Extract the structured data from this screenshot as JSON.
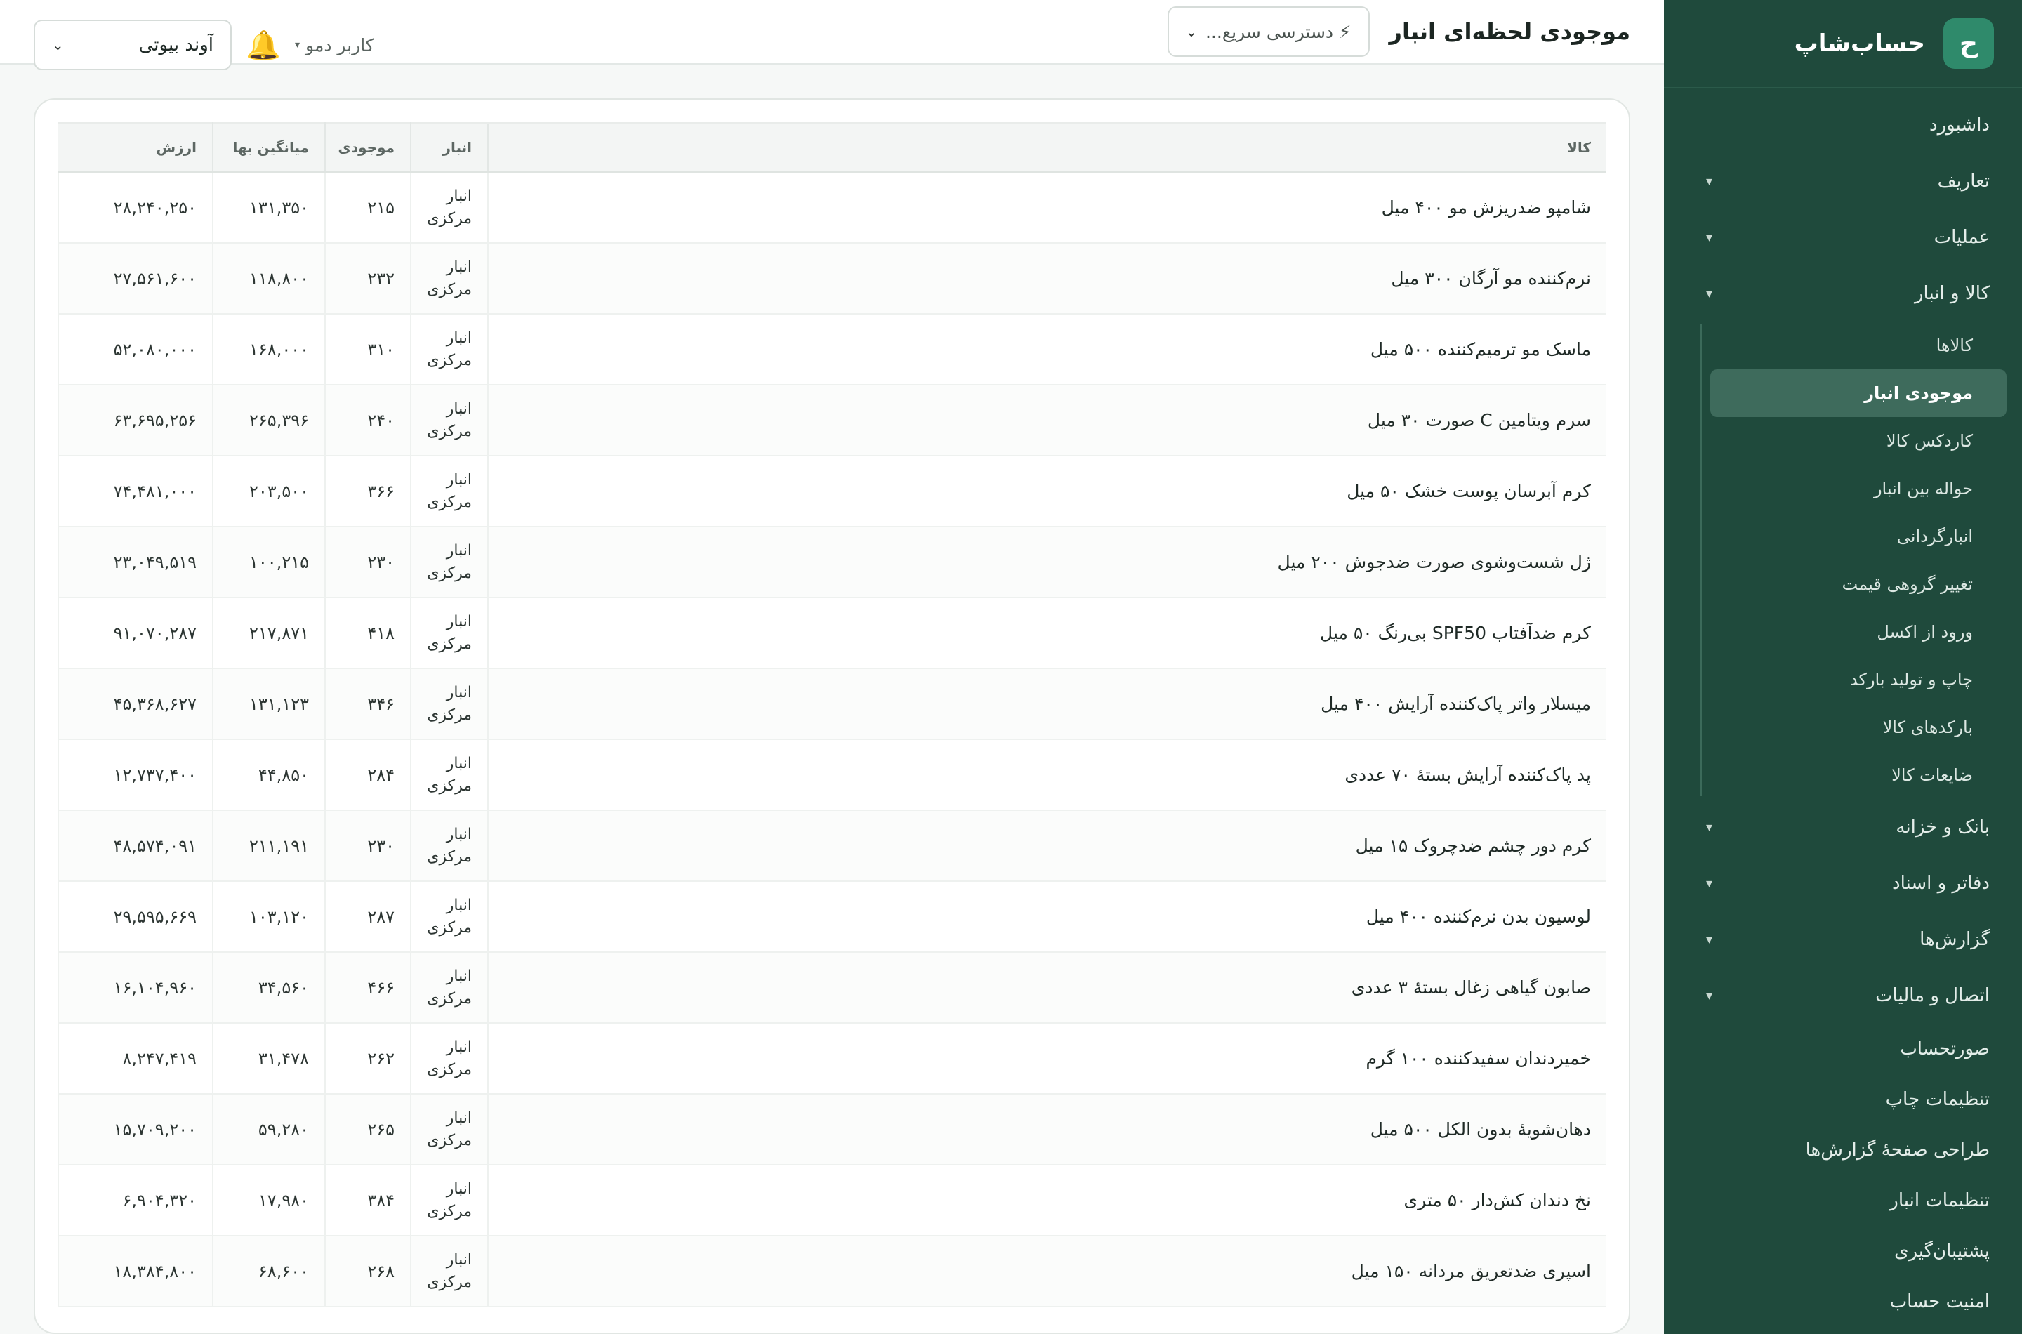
{
  "brand": {
    "logo_letter": "ح",
    "name": "حساب‌شاپ"
  },
  "sidebar": {
    "items": [
      {
        "label": "داشبورد"
      },
      {
        "label": "تعاریف",
        "caret": "▾"
      },
      {
        "label": "عملیات",
        "caret": "▾"
      },
      {
        "label": "کالا و انبار",
        "caret": "▾"
      }
    ],
    "sub_items": [
      {
        "label": "کالاها"
      },
      {
        "label": "موجودی انبار",
        "active": true
      },
      {
        "label": "کاردکس کالا"
      },
      {
        "label": "حواله بین انبار"
      },
      {
        "label": "انبارگردانی"
      },
      {
        "label": "تغییر گروهی قیمت"
      },
      {
        "label": "ورود از اکسل"
      },
      {
        "label": "چاپ و تولید بارکد"
      },
      {
        "label": "بارکدهای کالا"
      },
      {
        "label": "ضایعات کالا"
      }
    ],
    "items_after": [
      {
        "label": "بانک و خزانه",
        "caret": "▾"
      },
      {
        "label": "دفاتر و اسناد",
        "caret": "▾"
      },
      {
        "label": "گزارش‌ها",
        "caret": "▾"
      },
      {
        "label": "اتصال و مالیات",
        "caret": "▾"
      }
    ],
    "plain_items": [
      {
        "label": "صورتحساب"
      },
      {
        "label": "تنظیمات چاپ"
      },
      {
        "label": "طراحی صفحهٔ گزارش‌ها"
      },
      {
        "label": "تنظیمات انبار"
      },
      {
        "label": "پشتیبان‌گیری"
      },
      {
        "label": "امنیت حساب"
      }
    ]
  },
  "header": {
    "title": "موجودی لحظه‌ای انبار",
    "quick_access": "⚡ دسترسی سریع...",
    "company": "آوند بیوتی",
    "user": "کاربر دمو",
    "user_caret": "▾",
    "bell_icon": "🔔",
    "chevron": "⌄"
  },
  "table": {
    "headers": {
      "product": "کالا",
      "warehouse": "انبار",
      "qty": "موجودی",
      "avg": "میانگین بها",
      "value": "ارزش"
    },
    "rows": [
      {
        "product": "شامپو ضدریزش مو ۴۰۰ میل",
        "warehouse": "انبار مرکزی",
        "qty": "۲۱۵",
        "avg": "۱۳۱,۳۵۰",
        "value": "۲۸,۲۴۰,۲۵۰"
      },
      {
        "product": "نرم‌کننده مو آرگان ۳۰۰ میل",
        "warehouse": "انبار مرکزی",
        "qty": "۲۳۲",
        "avg": "۱۱۸,۸۰۰",
        "value": "۲۷,۵۶۱,۶۰۰"
      },
      {
        "product": "ماسک مو ترمیم‌کننده ۵۰۰ میل",
        "warehouse": "انبار مرکزی",
        "qty": "۳۱۰",
        "avg": "۱۶۸,۰۰۰",
        "value": "۵۲,۰۸۰,۰۰۰"
      },
      {
        "product": "سرم ویتامین C صورت ۳۰ میل",
        "warehouse": "انبار مرکزی",
        "qty": "۲۴۰",
        "avg": "۲۶۵,۳۹۶",
        "value": "۶۳,۶۹۵,۲۵۶"
      },
      {
        "product": "کرم آبرسان پوست خشک ۵۰ میل",
        "warehouse": "انبار مرکزی",
        "qty": "۳۶۶",
        "avg": "۲۰۳,۵۰۰",
        "value": "۷۴,۴۸۱,۰۰۰"
      },
      {
        "product": "ژل شست‌وشوی صورت ضدجوش ۲۰۰ میل",
        "warehouse": "انبار مرکزی",
        "qty": "۲۳۰",
        "avg": "۱۰۰,۲۱۵",
        "value": "۲۳,۰۴۹,۵۱۹"
      },
      {
        "product": "کرم ضدآفتاب SPF50 بی‌رنگ ۵۰ میل",
        "warehouse": "انبار مرکزی",
        "qty": "۴۱۸",
        "avg": "۲۱۷,۸۷۱",
        "value": "۹۱,۰۷۰,۲۸۷"
      },
      {
        "product": "میسلار واتر پاک‌کننده آرایش ۴۰۰ میل",
        "warehouse": "انبار مرکزی",
        "qty": "۳۴۶",
        "avg": "۱۳۱,۱۲۳",
        "value": "۴۵,۳۶۸,۶۲۷"
      },
      {
        "product": "پد پاک‌کننده آرایش بستهٔ ۷۰ عددی",
        "warehouse": "انبار مرکزی",
        "qty": "۲۸۴",
        "avg": "۴۴,۸۵۰",
        "value": "۱۲,۷۳۷,۴۰۰"
      },
      {
        "product": "کرم دور چشم ضدچروک ۱۵ میل",
        "warehouse": "انبار مرکزی",
        "qty": "۲۳۰",
        "avg": "۲۱۱,۱۹۱",
        "value": "۴۸,۵۷۴,۰۹۱"
      },
      {
        "product": "لوسیون بدن نرم‌کننده ۴۰۰ میل",
        "warehouse": "انبار مرکزی",
        "qty": "۲۸۷",
        "avg": "۱۰۳,۱۲۰",
        "value": "۲۹,۵۹۵,۶۶۹"
      },
      {
        "product": "صابون گیاهی زغال بستهٔ ۳ عددی",
        "warehouse": "انبار مرکزی",
        "qty": "۴۶۶",
        "avg": "۳۴,۵۶۰",
        "value": "۱۶,۱۰۴,۹۶۰"
      },
      {
        "product": "خمیردندان سفیدکننده ۱۰۰ گرم",
        "warehouse": "انبار مرکزی",
        "qty": "۲۶۲",
        "avg": "۳۱,۴۷۸",
        "value": "۸,۲۴۷,۴۱۹"
      },
      {
        "product": "دهان‌شویهٔ بدون الکل ۵۰۰ میل",
        "warehouse": "انبار مرکزی",
        "qty": "۲۶۵",
        "avg": "۵۹,۲۸۰",
        "value": "۱۵,۷۰۹,۲۰۰"
      },
      {
        "product": "نخ دندان کش‌دار ۵۰ متری",
        "warehouse": "انبار مرکزی",
        "qty": "۳۸۴",
        "avg": "۱۷,۹۸۰",
        "value": "۶,۹۰۴,۳۲۰"
      },
      {
        "product": "اسپری ضدتعریق مردانه ۱۵۰ میل",
        "warehouse": "انبار مرکزی",
        "qty": "۲۶۸",
        "avg": "۶۸,۶۰۰",
        "value": "۱۸,۳۸۴,۸۰۰"
      }
    ]
  },
  "colors": {
    "sidebar": "#1f4a3c",
    "accent": "#2f8a6b",
    "bell": "#f0b429"
  }
}
